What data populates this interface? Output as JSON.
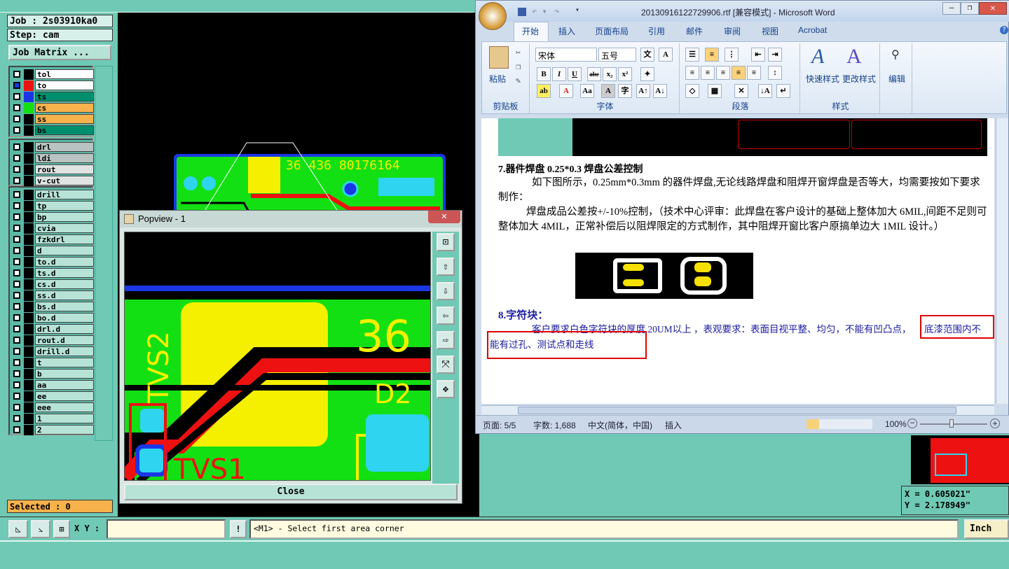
{
  "cam": {
    "job": "Job : 2s03910ka0",
    "step": "Step: cam",
    "job_matrix": "Job Matrix ...",
    "selected": "Selected : 0",
    "xy_label": "X Y :",
    "prompt": "<M1> - Select first area corner",
    "unit": "Inch",
    "coord_x": "X = 0.605021\"",
    "coord_y": "Y = 2.178949\"",
    "layers_top": [
      {
        "name": "tol",
        "color": "#ffffff",
        "swatch": "#000000"
      },
      {
        "name": "to",
        "color": "#ffffff",
        "swatch": "#ee1111"
      },
      {
        "name": "ts",
        "color": "#008f6d",
        "swatch": "#1a37e6"
      },
      {
        "name": "cs",
        "color": "#f7b24c",
        "swatch": "#13e013"
      },
      {
        "name": "ss",
        "color": "#f7b24c",
        "swatch": "#000000"
      },
      {
        "name": "bs",
        "color": "#008f6d",
        "swatch": "#000000"
      }
    ],
    "layers_mid": [
      {
        "name": "drl",
        "color": "#b9c3c1"
      },
      {
        "name": "ldi",
        "color": "#b9c3c1"
      },
      {
        "name": "rout",
        "color": "#dfe4e3"
      },
      {
        "name": "v-cut",
        "color": "#dfe4e3"
      }
    ],
    "layers_bottom": [
      "drill",
      "tp",
      "bp",
      "cvia",
      "fzkdrl",
      "d",
      "to.d",
      "ts.d",
      "cs.d",
      "ss.d",
      "bs.d",
      "bo.d",
      "drl.d",
      "rout.d",
      "drill.d",
      "t",
      "b",
      "aa",
      "ee",
      "eee",
      "1",
      "2"
    ],
    "board_text": "36 436 80176164"
  },
  "popview": {
    "title": "Popview - 1",
    "close_label": "Close",
    "labels": [
      "TVS2",
      "36",
      "D2",
      "TVS1"
    ]
  },
  "word": {
    "title": "20130916122729906.rtf [兼容模式] - Microsoft Word",
    "tabs": [
      "开始",
      "插入",
      "页面布局",
      "引用",
      "邮件",
      "审阅",
      "视图",
      "Acrobat"
    ],
    "groups": [
      "剪贴板",
      "字体",
      "段落",
      "样式"
    ],
    "paste": "粘贴",
    "font_name": "宋体",
    "font_size": "五号",
    "quick_style": "快速样式",
    "change_style": "更改样式",
    "edit": "编辑",
    "heading7": "7.器件焊盘 0.25*0.3 焊盘公差控制",
    "para1": "如下图所示，0.25mm*0.3mm 的器件焊盘,无论线路焊盘和阻焊开窗焊盘是否等大，均需要按如下要求制作：",
    "para2": "焊盘成品公差按+/-10%控制，（技术中心评审：此焊盘在客户设计的基础上整体加大 6MIL,间距不足则可整体加大 4MIL，正常补偿后以阻焊限定的方式制作，其中阻焊开窗比客户原搞单边大 1MIL 设计。）",
    "heading8": "8.字符块：",
    "para3a": "客户要求白色字符块的厚度 20UM以上 ，表观要求：表面目视平整、均匀，不能有凹凸点，",
    "para3b": "底漆范围内不",
    "para3c": "能有过孔、测试点和走线",
    "status_page": "页面: 5/5",
    "status_words": "字数: 1,688",
    "status_lang": "中文(简体，中国)",
    "status_insert": "插入",
    "zoom": "100%"
  }
}
